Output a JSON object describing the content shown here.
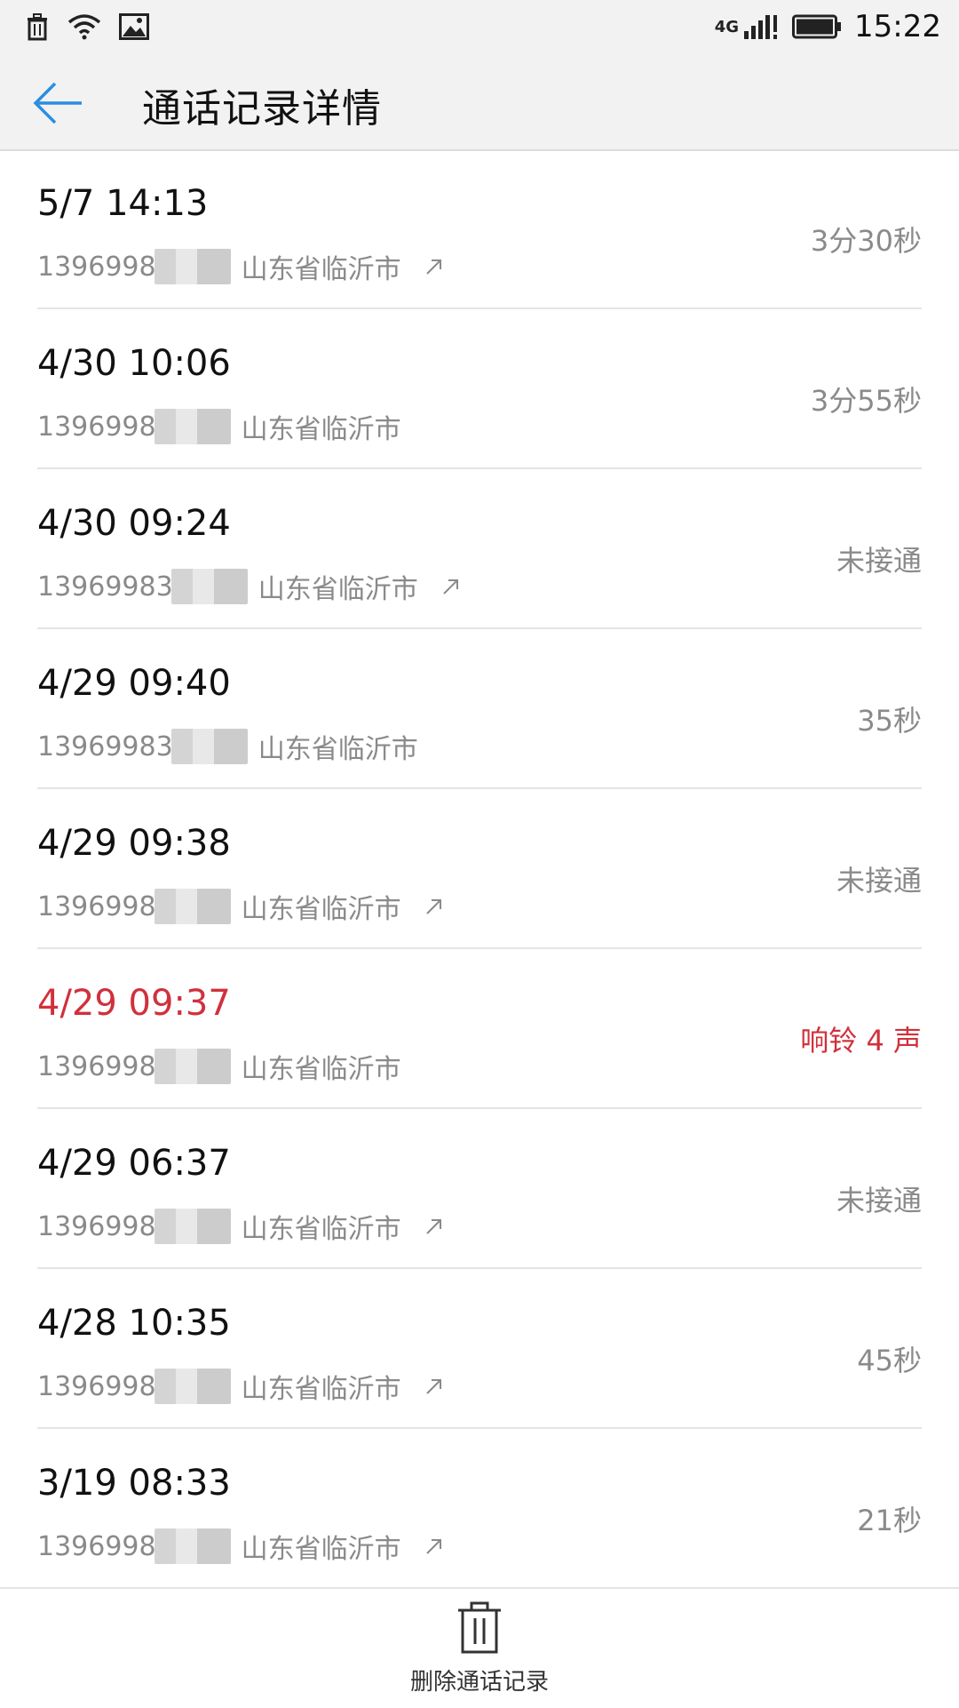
{
  "status_bar": {
    "network": "4G",
    "time": "15:22",
    "left_icons": [
      "trash-icon",
      "wifi-icon",
      "image-icon"
    ],
    "right_icons": [
      "signal-icon",
      "battery-icon"
    ]
  },
  "header": {
    "title": "通话记录详情",
    "accent_color": "#2b8ee0"
  },
  "calls": [
    {
      "date": "5/7 14:13",
      "number": "1396998",
      "location": "山东省临沂市",
      "arrow": true,
      "status": "3分30秒",
      "missed": false
    },
    {
      "date": "4/30 10:06",
      "number": "1396998",
      "location": "山东省临沂市",
      "arrow": false,
      "status": "3分55秒",
      "missed": false
    },
    {
      "date": "4/30 09:24",
      "number": "13969983",
      "location": "山东省临沂市",
      "arrow": true,
      "status": "未接通",
      "missed": false
    },
    {
      "date": "4/29 09:40",
      "number": "13969983",
      "location": "山东省临沂市",
      "arrow": false,
      "status": "35秒",
      "missed": false
    },
    {
      "date": "4/29 09:38",
      "number": "1396998",
      "location": "山东省临沂市",
      "arrow": true,
      "status": "未接通",
      "missed": false
    },
    {
      "date": "4/29 09:37",
      "number": "1396998",
      "location": "山东省临沂市",
      "arrow": false,
      "status": "响铃 4 声",
      "missed": true
    },
    {
      "date": "4/29 06:37",
      "number": "1396998",
      "location": "山东省临沂市",
      "arrow": true,
      "status": "未接通",
      "missed": false
    },
    {
      "date": "4/28 10:35",
      "number": "1396998",
      "location": "山东省临沂市",
      "arrow": true,
      "status": "45秒",
      "missed": false
    },
    {
      "date": "3/19 08:33",
      "number": "1396998",
      "location": "山东省临沂市",
      "arrow": true,
      "status": "21秒",
      "missed": false
    }
  ],
  "colors": {
    "missed": "#d0313c",
    "secondary_text": "#8a8a8a"
  },
  "bottom_bar": {
    "delete_label": "删除通话记录"
  }
}
